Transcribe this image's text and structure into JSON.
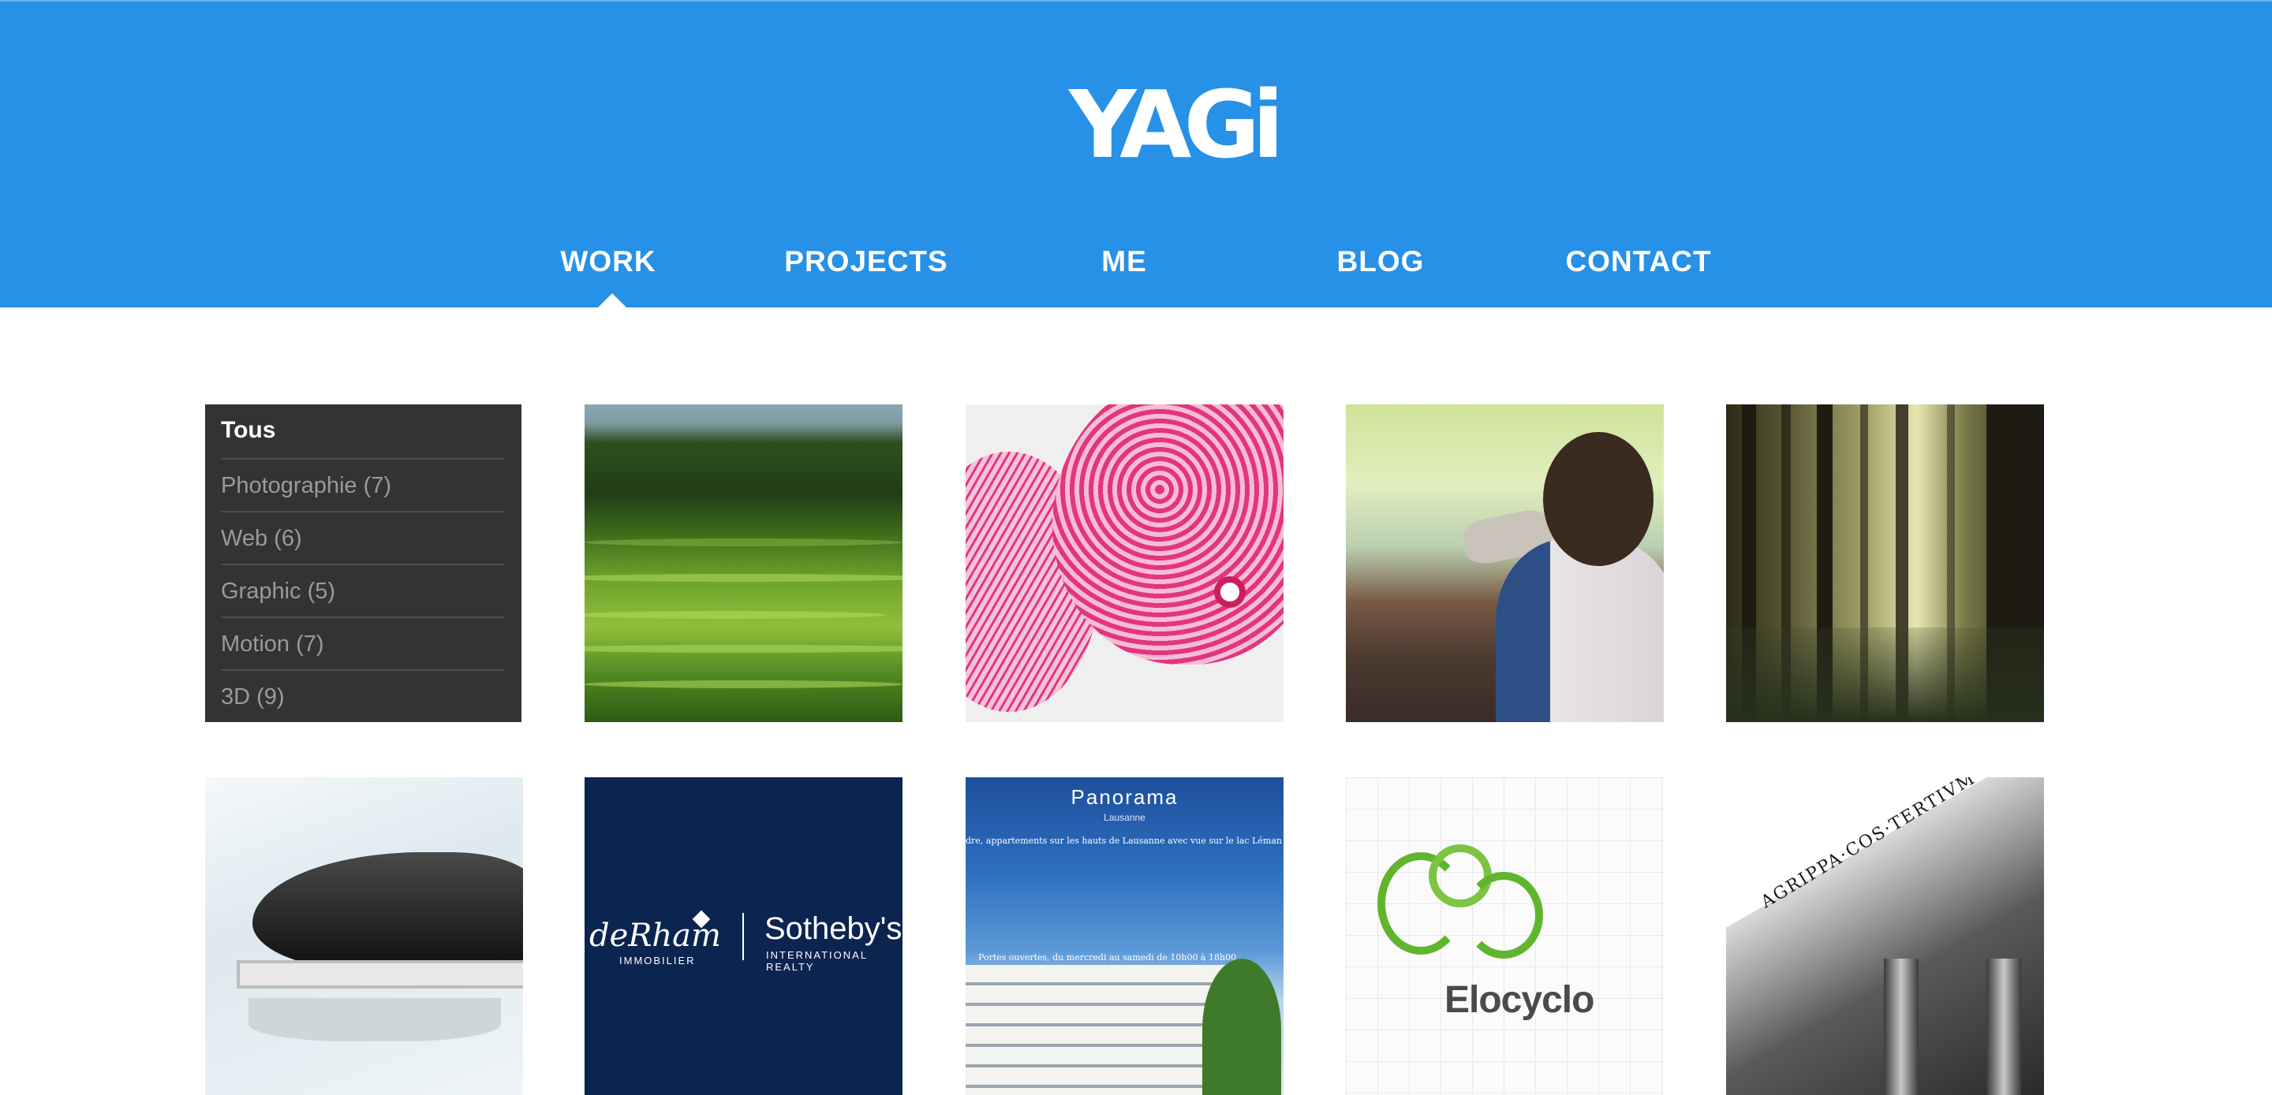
{
  "header": {
    "logo_text": "YAGi",
    "nav": [
      {
        "label": "WORK",
        "active": true
      },
      {
        "label": "PROJECTS",
        "active": false
      },
      {
        "label": "ME",
        "active": false
      },
      {
        "label": "BLOG",
        "active": false
      },
      {
        "label": "CONTACT",
        "active": false
      }
    ],
    "colors": {
      "header_bg": "#2691e6",
      "text": "#ffffff"
    }
  },
  "filter": {
    "title": "Tous",
    "items": [
      {
        "label": "Photographie (7)"
      },
      {
        "label": "Web (6)"
      },
      {
        "label": "Graphic (5)"
      },
      {
        "label": "Motion (7)"
      },
      {
        "label": "3D (9)"
      }
    ],
    "colors": {
      "panel_bg": "#333333",
      "item_text": "#9a9a9a"
    }
  },
  "thumbnails": {
    "derham": {
      "name": "deRham",
      "sub": "IMMOBILIER",
      "partner": "Sotheby's",
      "partner_sub": "INTERNATIONAL REALTY"
    },
    "panorama": {
      "title": "Panorama",
      "sub": "Lausanne",
      "desc": "dre, appartements sur les hauts de Lausanne avec vue sur le lac Léman et les A",
      "announcement": "Portes ouvertes, du mercredi au samedi de 10h00 à 18h00"
    },
    "elocyclo": {
      "name": "Elocyclo"
    },
    "pantheon": {
      "inscription": "AGRIPPA·COS·TERTIVM·FECIT"
    }
  }
}
